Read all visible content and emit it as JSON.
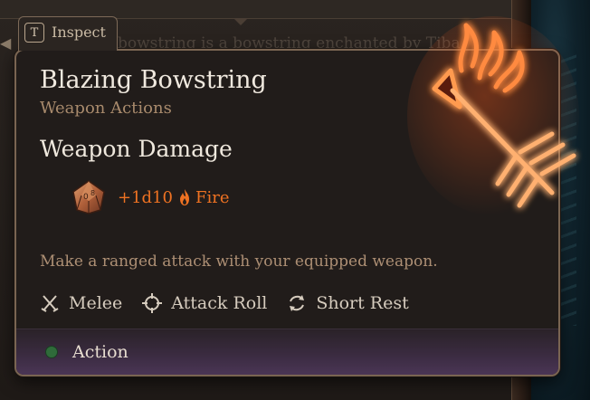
{
  "background": {
    "ghost_text": "bowstring is a bowstring enchanted by Tiba"
  },
  "inspect_tab": {
    "key": "T",
    "label": "Inspect"
  },
  "tooltip": {
    "title": "Blazing Bowstring",
    "subtitle": "Weapon Actions",
    "section_heading": "Weapon Damage",
    "damage": {
      "value": "+1d10",
      "type": "Fire",
      "color": "#ef7222"
    },
    "description": "Make a ranged attack with your equipped weapon.",
    "tags": [
      {
        "icon": "crossed-swords-icon",
        "label": "Melee"
      },
      {
        "icon": "crosshair-icon",
        "label": "Attack Roll"
      },
      {
        "icon": "short-rest-icon",
        "label": "Short Rest"
      }
    ],
    "footer": {
      "label": "Action",
      "dot_color": "#2f6b3a"
    }
  },
  "colors": {
    "accent_orange": "#ef7222",
    "subtitle_tan": "#a88a6c",
    "border": "#7a6552"
  }
}
